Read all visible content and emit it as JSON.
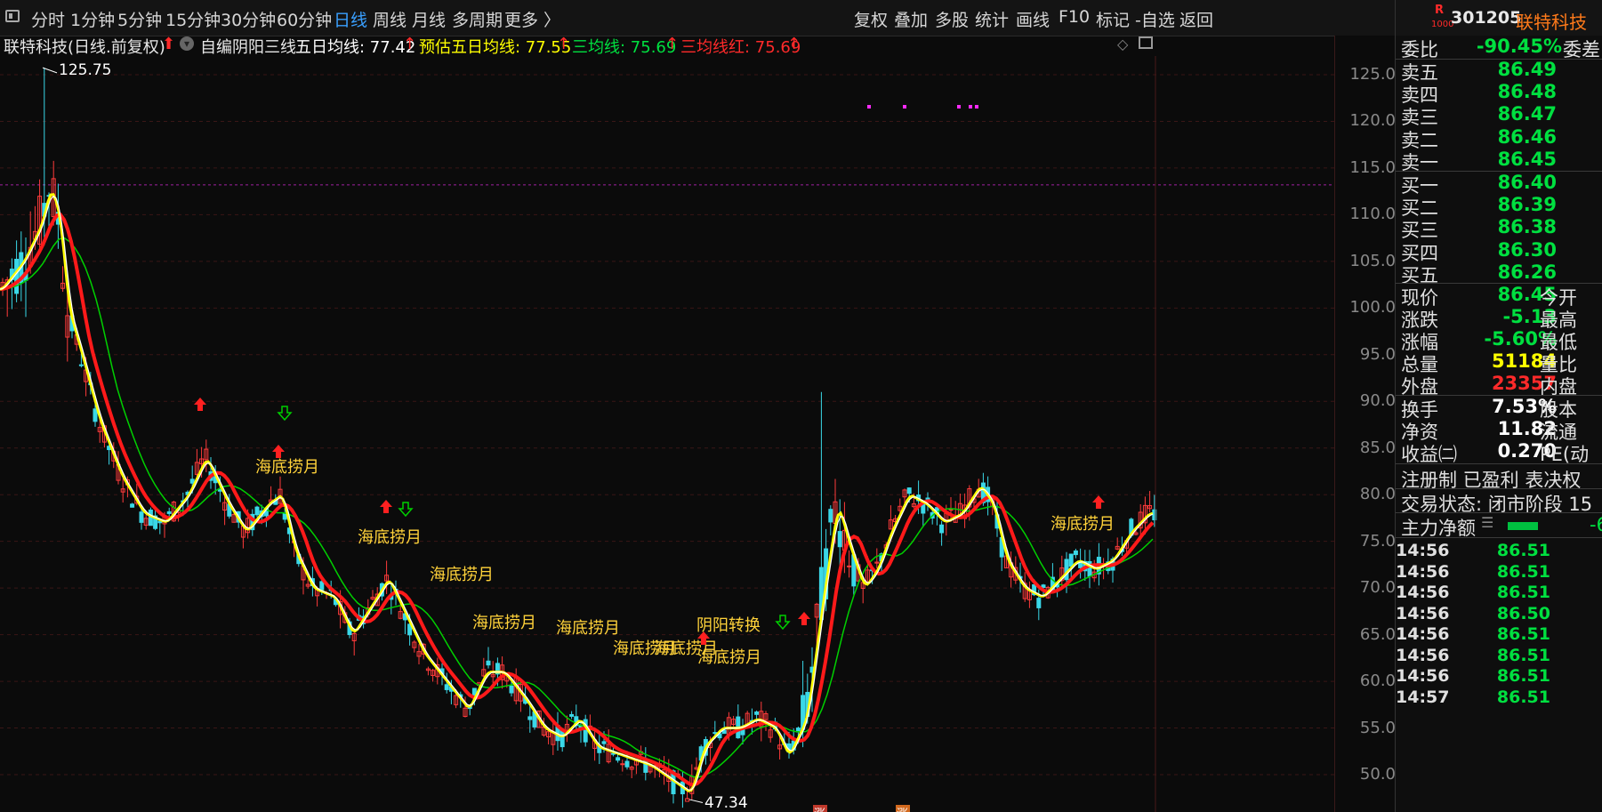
{
  "toolbar": {
    "items": [
      "分时",
      "1分钟",
      "5分钟",
      "15分钟",
      "30分钟",
      "60分钟",
      "日线",
      "周线",
      "月线",
      "多周期",
      "更多 〉"
    ],
    "active_index": 6,
    "right_items": [
      "复权",
      "叠加",
      "多股",
      "统计",
      "画线",
      "F10",
      "标记",
      "-自选",
      "返回"
    ]
  },
  "header": {
    "stock_code": "301205",
    "stock_name": "联特科技",
    "badge_r": "R",
    "badge_num": "1000"
  },
  "info": {
    "title": "联特科技(日线.前复权)",
    "indicator_name": "自编阴阳三线",
    "ma5_label": "五日均线: 77.42",
    "ma5_est_label": "预估五日均线: 77.55",
    "three_line_label": "三均线: 75.69",
    "three_line_red_label": "三均线红: 75.69",
    "arrow": "↑"
  },
  "chart_data": {
    "type": "candlestick",
    "ylim": [
      46,
      127
    ],
    "y_ticks": [
      "125.0",
      "120.0",
      "115.0",
      "110.0",
      "105.0",
      "100.0",
      "95.0",
      "90.0",
      "85.0",
      "80.0",
      "75.0",
      "70.0",
      "65.0",
      "60.0",
      "55.0",
      "50.0"
    ],
    "high_label": "125.75",
    "low_label": "47.34",
    "reference_price": 113.2,
    "annotation_text": "海底捞月",
    "annotation_text_alt": "阴阳转换",
    "mini_badges": [
      "涨",
      "涨"
    ],
    "colors": {
      "up": "#ff3b3b",
      "down": "#3ad8e8",
      "ma5": "#ffffff",
      "ma_est": "#ffff00",
      "green_line": "#00d000",
      "red_line": "#ff1a1a"
    }
  },
  "quote": {
    "weibi_label": "委比",
    "weibi_value": "-90.45%",
    "weicha_label": "委差",
    "sells": [
      [
        "卖五",
        "86.49"
      ],
      [
        "卖四",
        "86.48"
      ],
      [
        "卖三",
        "86.47"
      ],
      [
        "卖二",
        "86.46"
      ],
      [
        "卖一",
        "86.45"
      ]
    ],
    "buys": [
      [
        "买一",
        "86.40"
      ],
      [
        "买二",
        "86.39"
      ],
      [
        "买三",
        "86.38"
      ],
      [
        "买四",
        "86.30"
      ],
      [
        "买五",
        "86.26"
      ]
    ],
    "stats": [
      [
        "现价",
        "86.45",
        "今开",
        "#00e040"
      ],
      [
        "涨跌",
        "-5.13",
        "最高",
        "#00e040"
      ],
      [
        "涨幅",
        "-5.60%",
        "最低",
        "#00e040"
      ],
      [
        "总量",
        "51184",
        "量比",
        "#ffff00"
      ],
      [
        "外盘",
        "23357",
        "内盘",
        "#ff2a2a"
      ]
    ],
    "stats2": [
      [
        "换手",
        "7.53%",
        "股本"
      ],
      [
        "净资",
        "11.82",
        "流通"
      ],
      [
        "收益㈡",
        "0.270",
        "PE(动"
      ]
    ],
    "reg_line": "注册制 已盈利 表决权",
    "trade_status": "交易状态: 闭市阶段 15",
    "main_flow_label": "主力净额",
    "main_flow_value": "-6",
    "ticks": [
      [
        "14:56",
        "86.51"
      ],
      [
        "14:56",
        "86.51"
      ],
      [
        "14:56",
        "86.51"
      ],
      [
        "14:56",
        "86.50"
      ],
      [
        "14:56",
        "86.51"
      ],
      [
        "14:56",
        "86.51"
      ],
      [
        "14:56",
        "86.51"
      ],
      [
        "14:57",
        "86.51"
      ]
    ]
  }
}
